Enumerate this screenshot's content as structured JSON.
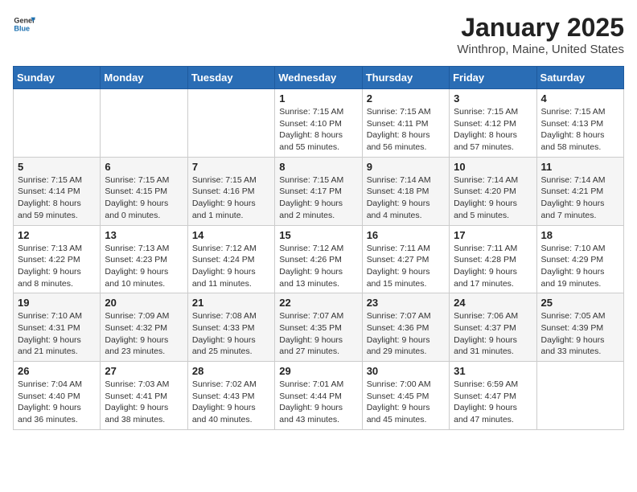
{
  "header": {
    "logo_general": "General",
    "logo_blue": "Blue",
    "title": "January 2025",
    "subtitle": "Winthrop, Maine, United States"
  },
  "days_of_week": [
    "Sunday",
    "Monday",
    "Tuesday",
    "Wednesday",
    "Thursday",
    "Friday",
    "Saturday"
  ],
  "weeks": [
    [
      {
        "day": "",
        "info": ""
      },
      {
        "day": "",
        "info": ""
      },
      {
        "day": "",
        "info": ""
      },
      {
        "day": "1",
        "info": "Sunrise: 7:15 AM\nSunset: 4:10 PM\nDaylight: 8 hours\nand 55 minutes."
      },
      {
        "day": "2",
        "info": "Sunrise: 7:15 AM\nSunset: 4:11 PM\nDaylight: 8 hours\nand 56 minutes."
      },
      {
        "day": "3",
        "info": "Sunrise: 7:15 AM\nSunset: 4:12 PM\nDaylight: 8 hours\nand 57 minutes."
      },
      {
        "day": "4",
        "info": "Sunrise: 7:15 AM\nSunset: 4:13 PM\nDaylight: 8 hours\nand 58 minutes."
      }
    ],
    [
      {
        "day": "5",
        "info": "Sunrise: 7:15 AM\nSunset: 4:14 PM\nDaylight: 8 hours\nand 59 minutes."
      },
      {
        "day": "6",
        "info": "Sunrise: 7:15 AM\nSunset: 4:15 PM\nDaylight: 9 hours\nand 0 minutes."
      },
      {
        "day": "7",
        "info": "Sunrise: 7:15 AM\nSunset: 4:16 PM\nDaylight: 9 hours\nand 1 minute."
      },
      {
        "day": "8",
        "info": "Sunrise: 7:15 AM\nSunset: 4:17 PM\nDaylight: 9 hours\nand 2 minutes."
      },
      {
        "day": "9",
        "info": "Sunrise: 7:14 AM\nSunset: 4:18 PM\nDaylight: 9 hours\nand 4 minutes."
      },
      {
        "day": "10",
        "info": "Sunrise: 7:14 AM\nSunset: 4:20 PM\nDaylight: 9 hours\nand 5 minutes."
      },
      {
        "day": "11",
        "info": "Sunrise: 7:14 AM\nSunset: 4:21 PM\nDaylight: 9 hours\nand 7 minutes."
      }
    ],
    [
      {
        "day": "12",
        "info": "Sunrise: 7:13 AM\nSunset: 4:22 PM\nDaylight: 9 hours\nand 8 minutes."
      },
      {
        "day": "13",
        "info": "Sunrise: 7:13 AM\nSunset: 4:23 PM\nDaylight: 9 hours\nand 10 minutes."
      },
      {
        "day": "14",
        "info": "Sunrise: 7:12 AM\nSunset: 4:24 PM\nDaylight: 9 hours\nand 11 minutes."
      },
      {
        "day": "15",
        "info": "Sunrise: 7:12 AM\nSunset: 4:26 PM\nDaylight: 9 hours\nand 13 minutes."
      },
      {
        "day": "16",
        "info": "Sunrise: 7:11 AM\nSunset: 4:27 PM\nDaylight: 9 hours\nand 15 minutes."
      },
      {
        "day": "17",
        "info": "Sunrise: 7:11 AM\nSunset: 4:28 PM\nDaylight: 9 hours\nand 17 minutes."
      },
      {
        "day": "18",
        "info": "Sunrise: 7:10 AM\nSunset: 4:29 PM\nDaylight: 9 hours\nand 19 minutes."
      }
    ],
    [
      {
        "day": "19",
        "info": "Sunrise: 7:10 AM\nSunset: 4:31 PM\nDaylight: 9 hours\nand 21 minutes."
      },
      {
        "day": "20",
        "info": "Sunrise: 7:09 AM\nSunset: 4:32 PM\nDaylight: 9 hours\nand 23 minutes."
      },
      {
        "day": "21",
        "info": "Sunrise: 7:08 AM\nSunset: 4:33 PM\nDaylight: 9 hours\nand 25 minutes."
      },
      {
        "day": "22",
        "info": "Sunrise: 7:07 AM\nSunset: 4:35 PM\nDaylight: 9 hours\nand 27 minutes."
      },
      {
        "day": "23",
        "info": "Sunrise: 7:07 AM\nSunset: 4:36 PM\nDaylight: 9 hours\nand 29 minutes."
      },
      {
        "day": "24",
        "info": "Sunrise: 7:06 AM\nSunset: 4:37 PM\nDaylight: 9 hours\nand 31 minutes."
      },
      {
        "day": "25",
        "info": "Sunrise: 7:05 AM\nSunset: 4:39 PM\nDaylight: 9 hours\nand 33 minutes."
      }
    ],
    [
      {
        "day": "26",
        "info": "Sunrise: 7:04 AM\nSunset: 4:40 PM\nDaylight: 9 hours\nand 36 minutes."
      },
      {
        "day": "27",
        "info": "Sunrise: 7:03 AM\nSunset: 4:41 PM\nDaylight: 9 hours\nand 38 minutes."
      },
      {
        "day": "28",
        "info": "Sunrise: 7:02 AM\nSunset: 4:43 PM\nDaylight: 9 hours\nand 40 minutes."
      },
      {
        "day": "29",
        "info": "Sunrise: 7:01 AM\nSunset: 4:44 PM\nDaylight: 9 hours\nand 43 minutes."
      },
      {
        "day": "30",
        "info": "Sunrise: 7:00 AM\nSunset: 4:45 PM\nDaylight: 9 hours\nand 45 minutes."
      },
      {
        "day": "31",
        "info": "Sunrise: 6:59 AM\nSunset: 4:47 PM\nDaylight: 9 hours\nand 47 minutes."
      },
      {
        "day": "",
        "info": ""
      }
    ]
  ]
}
